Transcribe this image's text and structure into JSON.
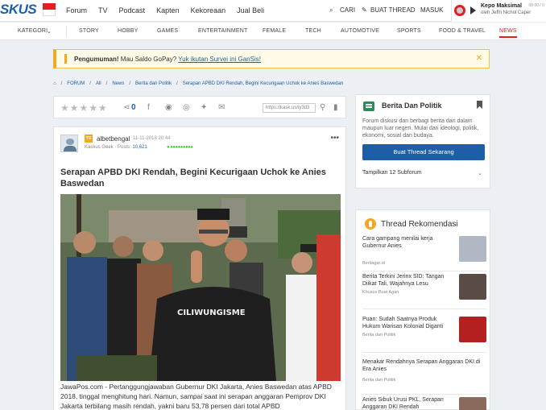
{
  "topbar": {
    "logo": "SKUS",
    "nav": [
      "Forum",
      "TV",
      "Podcast",
      "Kapten",
      "Kekoreaan",
      "Jual Beli"
    ],
    "cari": "CARI",
    "buat_thread": "BUAT THREAD",
    "masuk": "MASUK"
  },
  "music": {
    "title": "Kepo Maksimal",
    "artist": "oleh Jeffri Nichol Caper",
    "time": "00:00 / 0"
  },
  "categories": [
    "KATEGORI",
    "STORY",
    "HOBBY",
    "GAMES",
    "ENTERTAINMENT",
    "FEMALE",
    "TECH",
    "AUTOMOTIVE",
    "SPORTS",
    "FOOD & TRAVEL",
    "NEWS"
  ],
  "announcement": {
    "label": "Pengumuman!",
    "text": "Mau Saldo GoPay?",
    "link": "Yuk ikutan Survei ini GanSis!",
    "close": "✕"
  },
  "breadcrumb": [
    "FORUM",
    "All",
    "News",
    "Berita dan Politik",
    "Serapan APBD DKI Rendah, Begini Kecurigaan Uchok ke Anies Baswedan"
  ],
  "actions": {
    "share_count": "0",
    "url": "https://kask.us/iy3d3"
  },
  "post": {
    "badge": "TS",
    "username": "albetbengal",
    "date": "11-11-2018 20:44",
    "role": "Kaskus Geek",
    "posts_label": "Posts:",
    "posts_value": "10,621",
    "title": "Serapan APBD DKI Rendah, Begini Kecurigaan Uchok ke Anies Baswedan",
    "shirt": "CILIWUNGISME",
    "body": "JawaPos.com - Pertanggungjawaban Gubernur DKI Jakarta, Anies Baswedan atas APBD 2018, tinggal menghitung hari. Namun, sampai saat ini serapan anggaran Pemprov DKI Jakarta terbilang masih rendah, yakni baru 53,78 persen dari total APBD"
  },
  "forum_box": {
    "title": "Berita Dan Politik",
    "desc": "Forum diskusi dan berbagi berita dari dalam maupun luar negeri. Mulai dari ideologi, politik, ekonomi, sosial dan budaya.",
    "button": "Buat Thread Sekarang",
    "subforum": "Tampilkan 12 Subforum"
  },
  "recommendations": {
    "title": "Thread Rekomendasi",
    "items": [
      {
        "title": "Cara gampang menilai kerja Gubernur Anies",
        "source": "Beritagar.id"
      },
      {
        "title": "Berita Terkini Jerinx SID: Tangan Diikat Tali, Wajahnya Lesu",
        "source": "Khusus Buat Agan"
      },
      {
        "title": "Puan: Sudah Saatnya Produk Hukum Warisan Kolonial Diganti",
        "source": "Berita dan Politik"
      },
      {
        "title": "Menakar Rendahnya Serapan Anggaran DKI di Era Anies",
        "source": "Berita dan Politik"
      },
      {
        "title": "Anies Sibuk Urusi PKL, Serapan Anggaran DKI Rendah",
        "source": ""
      }
    ]
  },
  "colors": {
    "brand": "#1d5ea9",
    "accent": "#e21d24",
    "warning": "#f5a623"
  }
}
